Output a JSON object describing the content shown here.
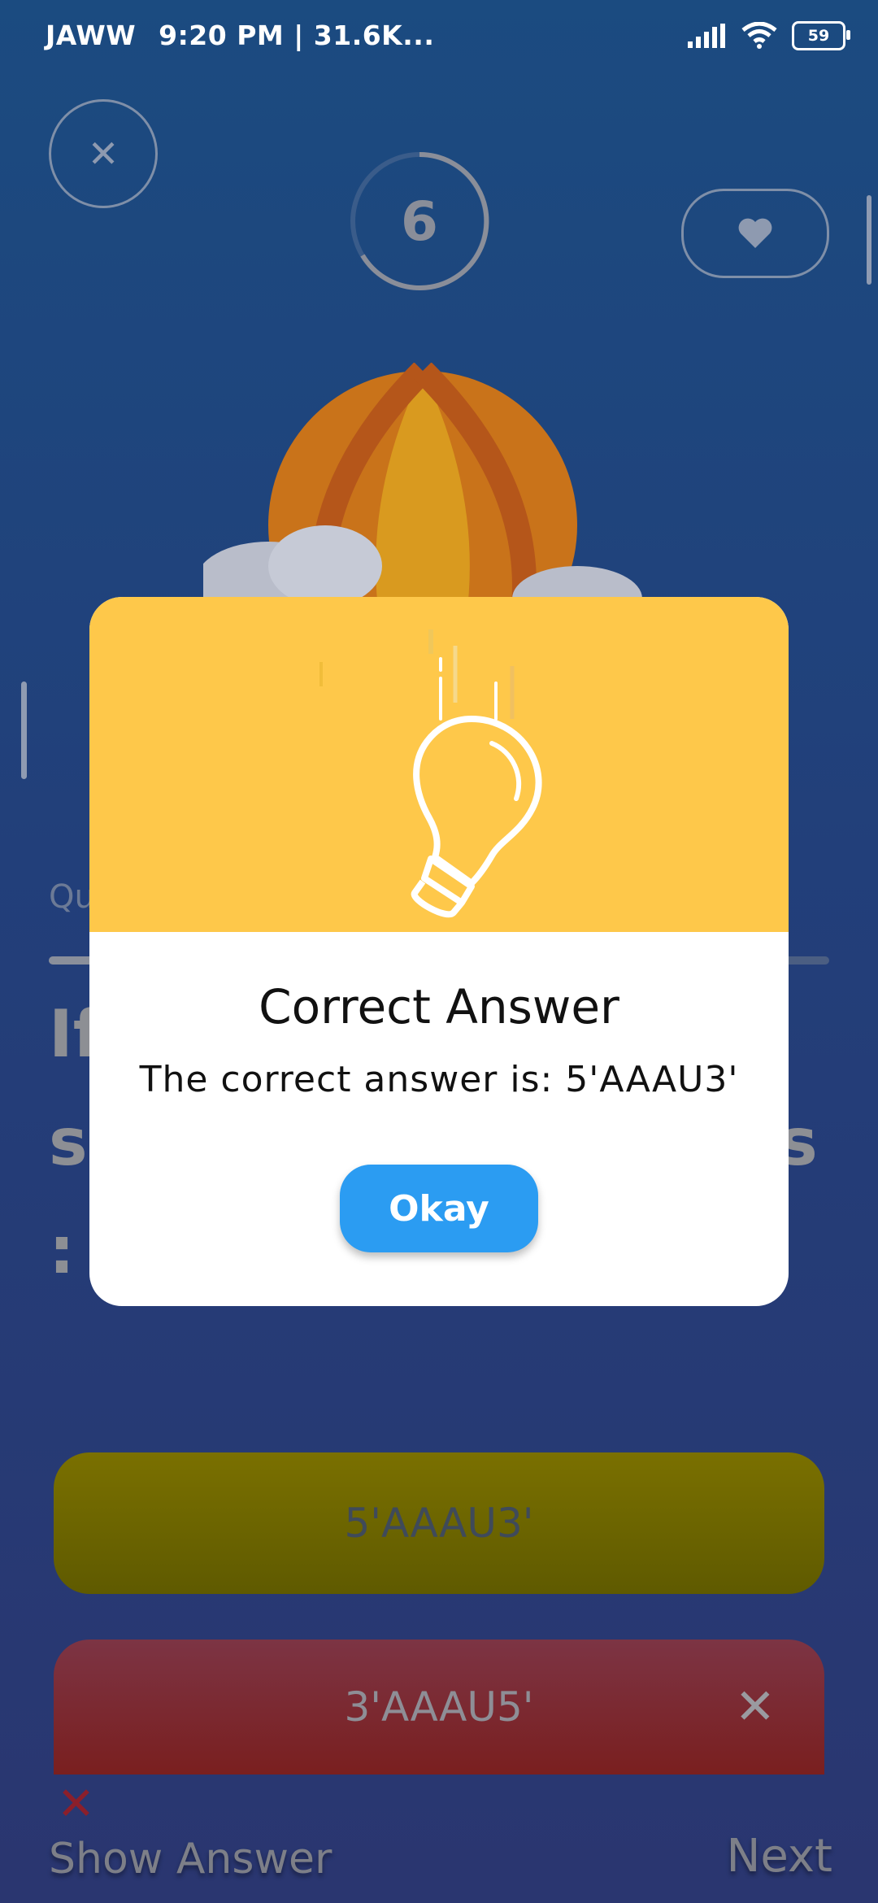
{
  "status_bar": {
    "carrier": "JAWW",
    "time_info": "9:20 PM | 31.6K...",
    "battery": "59"
  },
  "game": {
    "timer_value": "6",
    "question_label": "Qu",
    "question_text": "If ... in ... th ... sequence in mRNA is :",
    "options": [
      {
        "label": "5'AAAU3'",
        "state": "correct"
      },
      {
        "label": "3'AAAU5'",
        "state": "wrong"
      }
    ],
    "show_answer_label": "Show Answer",
    "next_label": "Next"
  },
  "dialog": {
    "title": "Correct Answer",
    "message": "The correct answer is: 5'AAAU3'",
    "button_label": "Okay",
    "header_icon": "light-bulb-icon"
  },
  "colors": {
    "dialog_header": "#fec84a",
    "okay_button": "#2b9cf2",
    "background_top": "#1b4b80"
  }
}
